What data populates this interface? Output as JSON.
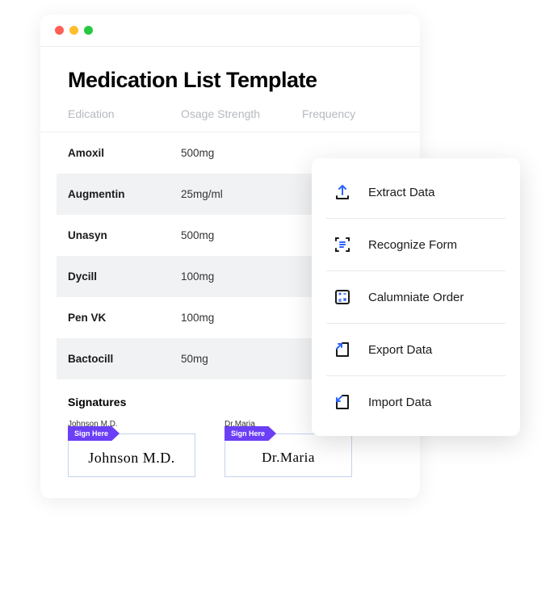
{
  "window": {
    "title": "Medication List Template"
  },
  "table": {
    "headers": {
      "col1": "Edication",
      "col2": "Osage Strength",
      "col3": "Frequency"
    },
    "rows": [
      {
        "name": "Amoxil",
        "strength": "500mg"
      },
      {
        "name": "Augmentin",
        "strength": "25mg/ml"
      },
      {
        "name": "Unasyn",
        "strength": "500mg"
      },
      {
        "name": "Dycill",
        "strength": "100mg"
      },
      {
        "name": "Pen VK",
        "strength": "100mg"
      },
      {
        "name": "Bactocill",
        "strength": "50mg"
      }
    ]
  },
  "signatures": {
    "title": "Signatures",
    "sign_here": "Sign Here",
    "blocks": [
      {
        "label": "Johnson M.D.",
        "script": "Johnson M.D."
      },
      {
        "label": "Dr.Maria",
        "script": "Dr.Maria"
      }
    ]
  },
  "actions": {
    "items": [
      {
        "label": "Extract Data"
      },
      {
        "label": "Recognize Form"
      },
      {
        "label": "Calumniate Order"
      },
      {
        "label": "Export Data"
      },
      {
        "label": "Import Data"
      }
    ]
  }
}
